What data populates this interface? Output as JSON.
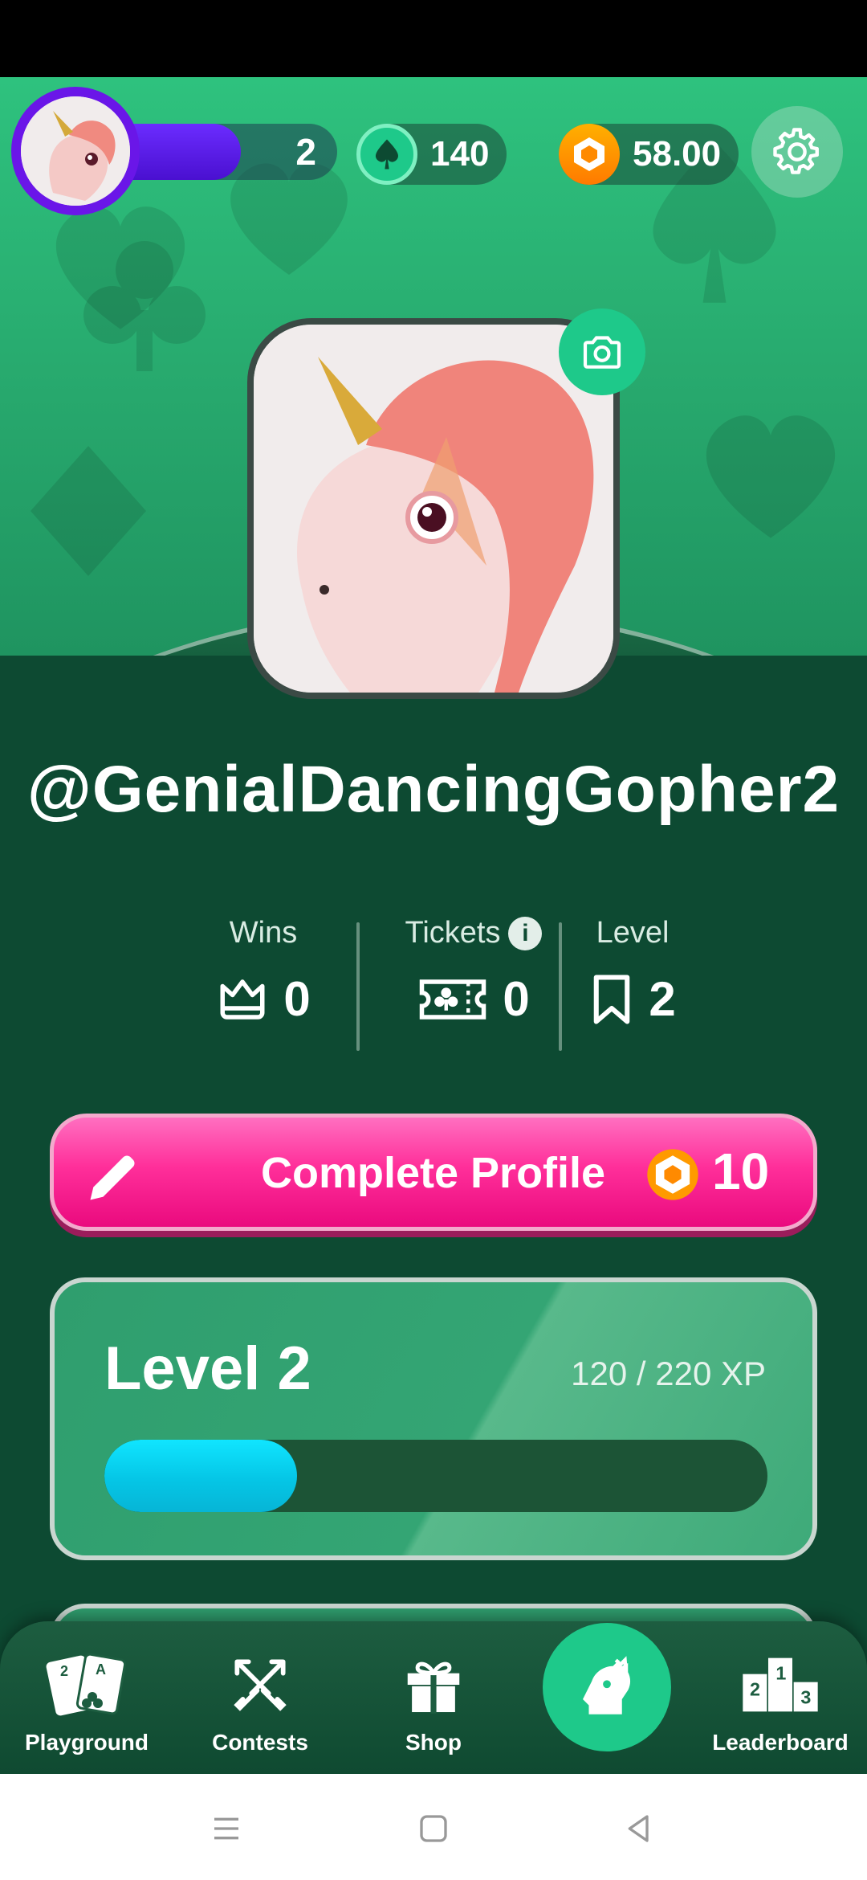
{
  "topbar": {
    "level": "2",
    "spades": "140",
    "coins": "58.00"
  },
  "profile": {
    "username": "@GenialDancingGopher2"
  },
  "stats": {
    "wins_label": "Wins",
    "wins_value": "0",
    "tickets_label": "Tickets",
    "tickets_value": "0",
    "info_glyph": "i",
    "level_label": "Level",
    "level_value": "2"
  },
  "complete_profile": {
    "label": "Complete Profile",
    "reward": "10"
  },
  "level_card": {
    "title": "Level 2",
    "xp_text": "120 / 220 XP",
    "progress": 0.29
  },
  "nav": {
    "items": [
      {
        "label": "Playground",
        "icon": "cards-icon"
      },
      {
        "label": "Contests",
        "icon": "swords-icon"
      },
      {
        "label": "Shop",
        "icon": "gift-icon"
      },
      {
        "label": "",
        "icon": "profile-knight-icon"
      },
      {
        "label": "Leaderboard",
        "icon": "podium-icon"
      }
    ]
  },
  "colors": {
    "accent_green": "#1ec98a",
    "pink": "#ff2f9a",
    "purple": "#6a16e8",
    "cyan": "#10e5ff"
  }
}
